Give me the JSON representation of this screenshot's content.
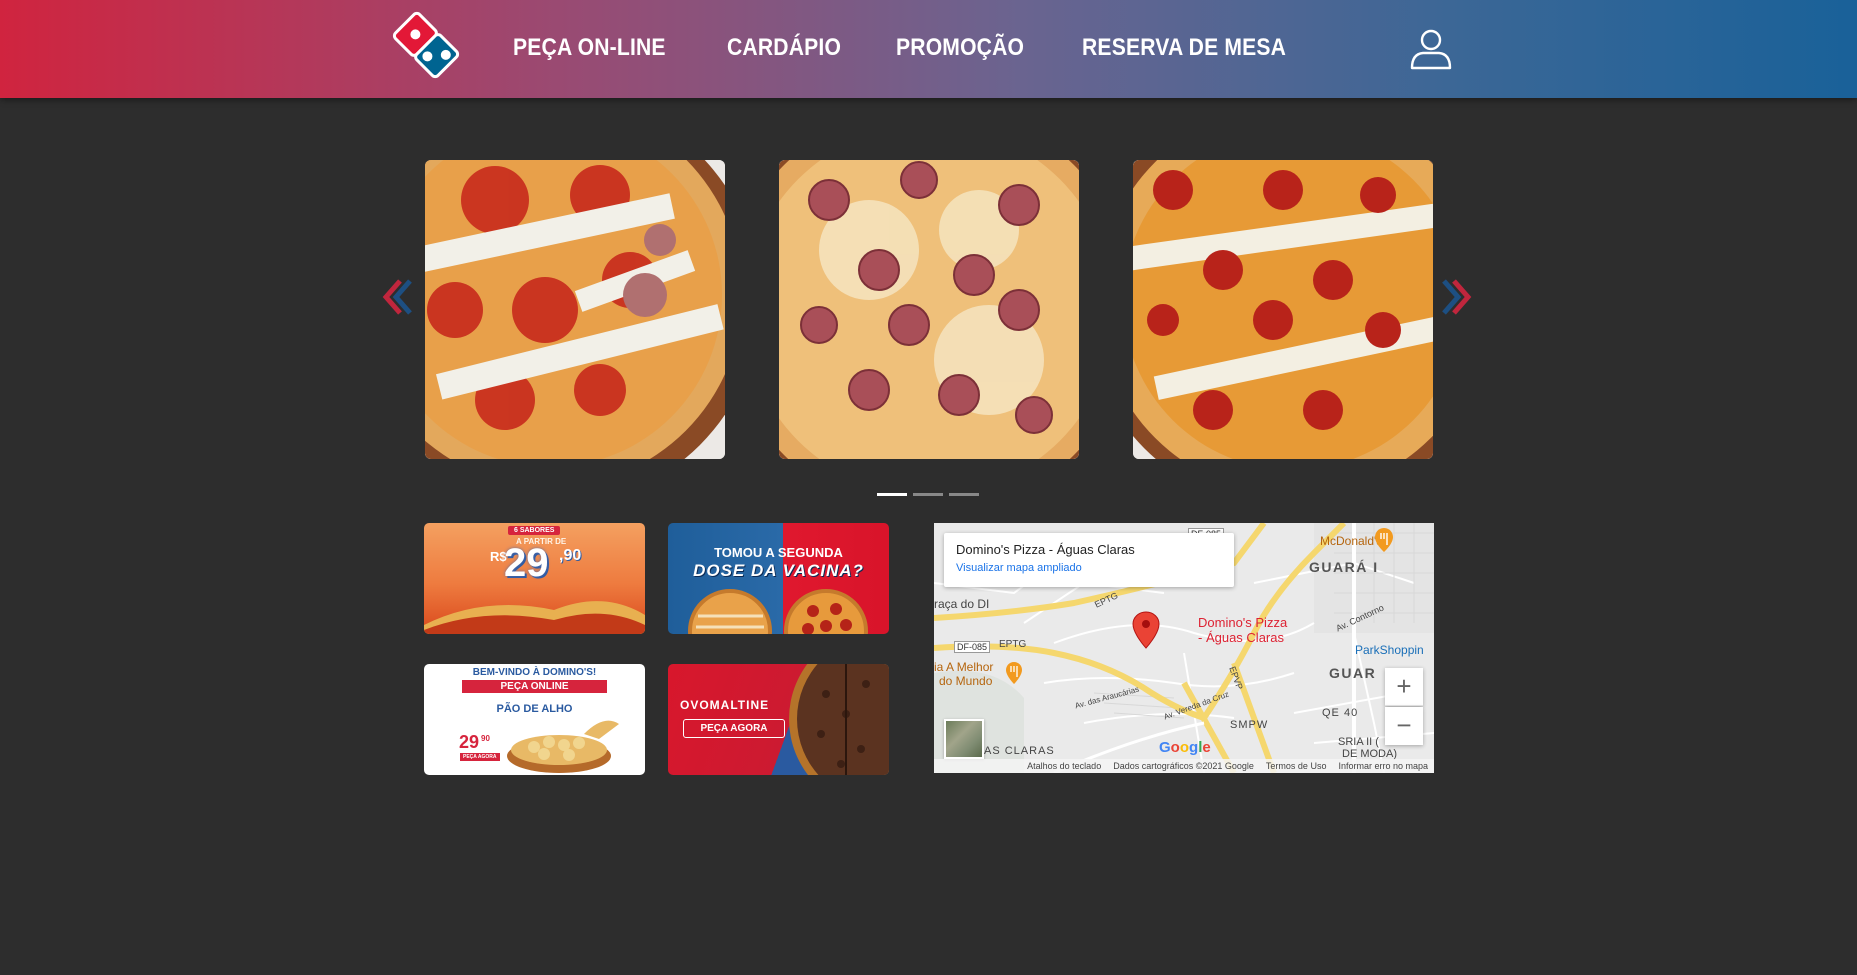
{
  "header": {
    "nav": [
      "PEÇA ON-LINE",
      "CARDÁPIO",
      "PROMOÇÃO",
      "RESERVA DE MESA"
    ],
    "brand_colors": {
      "red": "#e31837",
      "blue": "#006491"
    }
  },
  "carousel": {
    "slides": [
      {
        "name": "pizza-tomato-salami"
      },
      {
        "name": "pizza-salami"
      },
      {
        "name": "pizza-pepperoni"
      }
    ],
    "active_dot": 0,
    "dot_count": 3,
    "prev_icon": "chevron-left-icon",
    "next_icon": "chevron-right-icon"
  },
  "promos": {
    "p1": {
      "badge": "6 SABORES",
      "prefix": "A PARTIR DE",
      "currency": "R$",
      "price": "29",
      "cents": ",90"
    },
    "p2": {
      "line1": "TOMOU A SEGUNDA",
      "line2": "DOSE DA VACINA?"
    },
    "p3": {
      "line1": "BEM-VINDO À DOMINO'S!",
      "line2": "PEÇA ONLINE",
      "line3": "PÃO DE ALHO",
      "price": "29",
      "cents": "90",
      "cta": "PEÇA AGORA"
    },
    "p4": {
      "brand": "OVOMALTINE",
      "cta": "PEÇA AGORA"
    }
  },
  "map": {
    "card_title": "Domino's Pizza - Águas Claras",
    "card_link": "Visualizar mapa ampliado",
    "pin_label_1": "Domino's Pizza",
    "pin_label_2": "- Águas Claras",
    "labels": {
      "mcdonalds": "McDonald's",
      "guara1": "GUARÁ I",
      "guara": "GUAR",
      "parkshopping": "ParkShoppin",
      "praca": "raça do DI",
      "amelhor1": "ia A Melhor",
      "amelhor2": "do Mundo",
      "qe40": "QE 40",
      "smpw": "SMPW",
      "sria1": "SRIA II (",
      "sria2": "DE MODA)",
      "asclaras": "AS CLARAS",
      "av_araucarias": "Av. das Araucárias",
      "av_vereda": "Av. Vereda da Cruz",
      "av_contorno": "Av. Contorno",
      "eptg1": "EPTG",
      "eptg2": "EPTG",
      "epvp": "EPVP",
      "df085_1": "DF-085",
      "df085_2": "DF-085"
    },
    "zoom_in": "+",
    "zoom_out": "−",
    "google": "Google",
    "footer": [
      "Atalhos do teclado",
      "Dados cartográficos ©2021 Google",
      "Termos de Uso",
      "Informar erro no mapa"
    ]
  }
}
